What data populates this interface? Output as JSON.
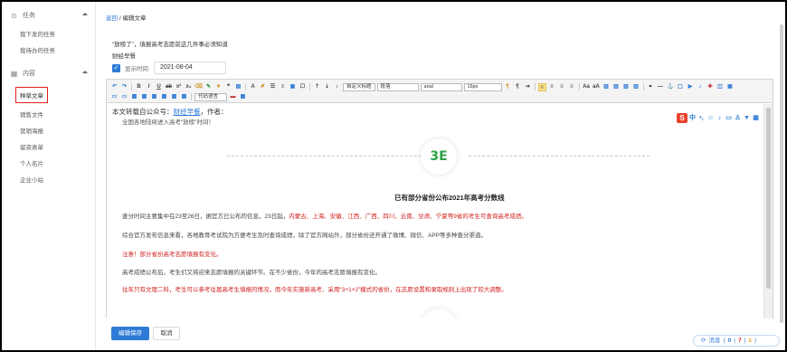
{
  "sidebar": {
    "group1": {
      "label": "任务",
      "icon": "circle-gear-icon"
    },
    "group1_items": [
      "我下发的任务",
      "我待办的任务"
    ],
    "group2": {
      "label": "内容",
      "icon": "grid-icon"
    },
    "group2_items": [
      "种草文章",
      "销售文件",
      "营销海报",
      "留资表单",
      "个人名片",
      "企业小站"
    ],
    "active_item": "种草文章"
  },
  "breadcrumb": {
    "back": "返回",
    "separator": "/",
    "current": "编辑文章"
  },
  "article": {
    "title": "“放榜了”，填报高考志愿前这几件事必须知道",
    "category": "财经早餐",
    "show_time_label": "显示时间",
    "show_time_value": "2021-08-04"
  },
  "toolbar": {
    "custom_title": "自定义标题",
    "paragraph": "段落",
    "font": "arial",
    "size": "16px",
    "code_lang": "代码语言"
  },
  "content": {
    "intro_prefix": "本文转载自公众号：",
    "intro_link": "财经早餐",
    "intro_suffix": "，作者：",
    "subline": "全国各地陆续进入高考“放榜”时间！",
    "logo_text": "3E",
    "heading": "已有部分省份公布2021年高考分数线",
    "p1_normal": "查分时间主要集中在23至26日，据官方已公布的信息，23日起，",
    "p1_red": "内蒙古、上海、安徽、江西、广西、四川、云南、甘肃、宁夏等9省的考生可查询高考成绩。",
    "p2": "综合官方发布信息来看，各地教育考试院为方便考生及时查询成绩，除了官方网站外，部分省份还开通了微博、微信、APP等多种查分渠道。",
    "p3": "注意！部分省份高考志愿填报有变化。",
    "p4": "高考成绩公布后，考生们又将迎来志愿填报的关键环节。在不少省份，今年的高考志愿填报有变化。",
    "p5": "往年只有文理二科，考生可以参考往届高考生填报的情况，而今年实施新高考、采用“3+1+2”模式的省份，在志愿设置和录取规则上出现了较大调整。"
  },
  "actions": {
    "save": "编辑保存",
    "cancel": "取消"
  },
  "messages": {
    "label": "消息",
    "v1": "0",
    "v2": "7",
    "v3": "1"
  },
  "colors": {
    "accent": "#2e7bd6",
    "red": "#d0201f",
    "logo_green": "#2da244"
  }
}
